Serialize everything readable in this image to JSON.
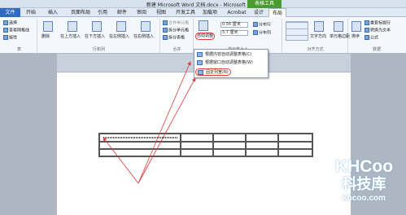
{
  "window": {
    "title": "新建 Microsoft Word 文档.docx - Microsoft Word",
    "context_title": "表格工具"
  },
  "tabs": [
    "文件",
    "开始",
    "插入",
    "页面布局",
    "引用",
    "邮件",
    "审阅",
    "视图",
    "开发工具",
    "加载项",
    "Acrobat",
    "设计",
    "布局"
  ],
  "ribbon": {
    "table_group": {
      "label": "表",
      "select": "选择",
      "gridlines": "查看网格线",
      "properties": "属性"
    },
    "rows_cols_group": {
      "label": "行和列",
      "delete": "删除",
      "insert_above": "在上方插入",
      "insert_below": "在下方插入",
      "insert_left": "在左侧插入",
      "insert_right": "在右侧插入"
    },
    "merge_group": {
      "label": "合并",
      "merge": "合并单元格",
      "split": "拆分单元格",
      "split_table": "拆分表格"
    },
    "cellsize_group": {
      "label": "单元格大小",
      "autofit": "自动调整",
      "height": "0.56 厘米",
      "width": "5.7 厘米",
      "distribute_rows": "分布行",
      "distribute_cols": "分布列"
    },
    "align_group": {
      "label": "对齐方式",
      "text_direction": "文字方向",
      "margins": "单元格边距"
    },
    "data_group": {
      "label": "数据",
      "sort": "排序",
      "repeat_header": "重复标题行",
      "to_text": "转换为文本",
      "formula": "公式"
    }
  },
  "dropdown": {
    "items": [
      "根据内容自动调整表格(C)",
      "根据窗口自动调整表格(W)",
      "固定列宽(N)"
    ]
  },
  "logo": {
    "brand": "KHCoo",
    "cn": "科技库",
    "url": "khcoo.com"
  },
  "colors": {
    "annotation": "#e03a3a",
    "accent": "#2e6bc2",
    "context": "#4b9a32"
  }
}
